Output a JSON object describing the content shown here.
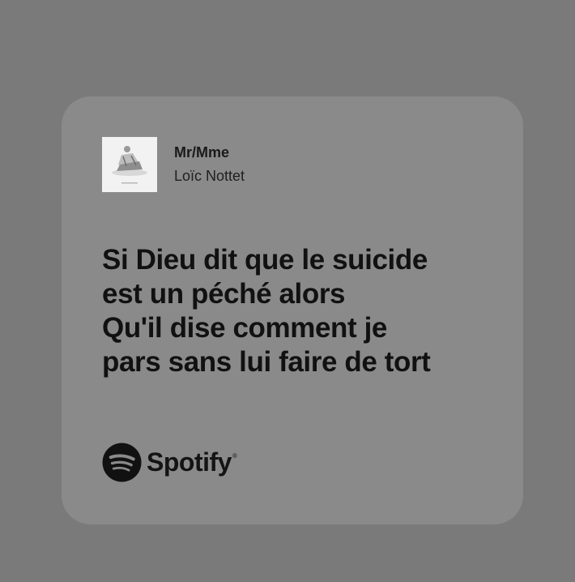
{
  "track": {
    "title": "Mr/Mme",
    "artist": "Loïc Nottet"
  },
  "lyrics": [
    "Si Dieu dit que le suicide",
    "est un péché alors",
    "Qu'il dise comment je",
    "pars sans lui faire de tort"
  ],
  "brand": {
    "name": "Spotify",
    "logo_icon": "spotify-logo-icon"
  },
  "colors": {
    "page_background": "#7a7a7a",
    "card_background": "#8a8a8a",
    "text": "#111111"
  }
}
